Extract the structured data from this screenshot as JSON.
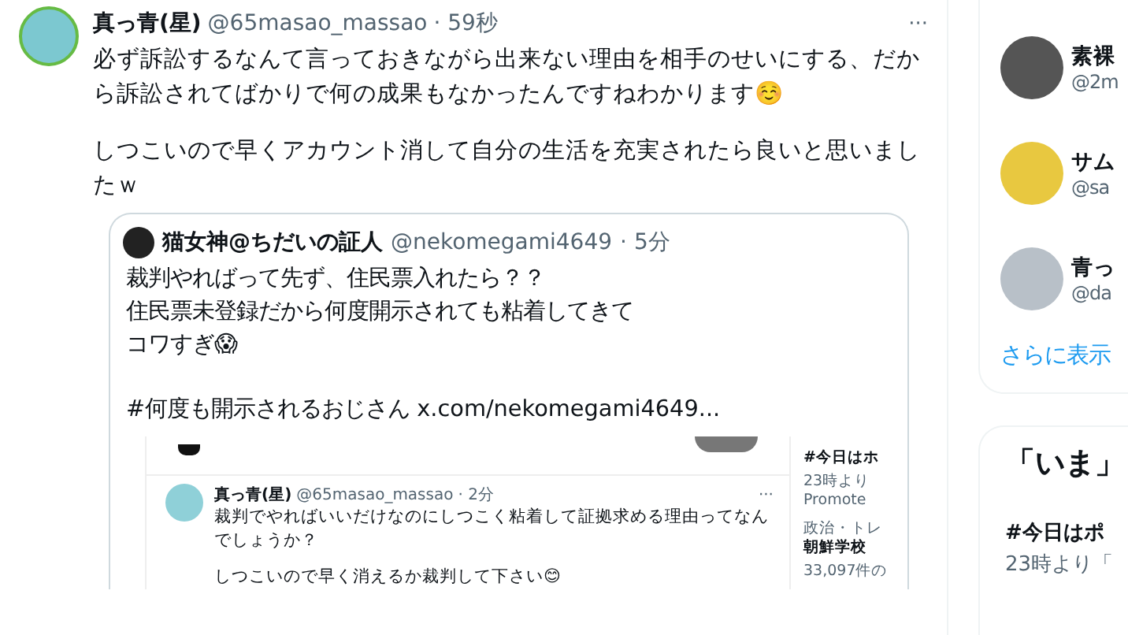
{
  "tweet": {
    "name": "真っ青(星)",
    "handle": "@65masao_massao",
    "time": "· 59秒",
    "more": "···",
    "paragraphs": [
      "必ず訴訟するなんて言っておきながら出来ない理由を相手のせいにする、だから訴訟されてばかりで何の成果もなかったんですねわかります☺️",
      "しつこいので早くアカウント消して自分の生活を充実されたら良いと思いましたｗ"
    ],
    "quote": {
      "name": "猫女神@ちだいの証人",
      "handle": "@nekomegami4649",
      "time": "· 5分",
      "paragraphs": [
        [
          "裁判やればって先ず、住民票入れたら？？",
          "住民票未登録だから何度開示されても粘着してきて",
          "コワすぎ😱"
        ],
        [
          "#何度も開示されるおじさん  x.com/nekomegami4649..."
        ]
      ],
      "image": {
        "tweet": {
          "name": "真っ青(星)",
          "handle": "@65masao_massao",
          "time": "· 2分",
          "more": "···",
          "paragraphs": [
            [
              "裁判でやればいいだけなのにしつこく粘着して証拠求める理由ってなんでしょうか？"
            ],
            [
              "しつこいので早く消えるか裁判して下さい😊"
            ]
          ]
        },
        "trends": [
          {
            "kind": "title",
            "text": "#今日はホ"
          },
          {
            "kind": "meta",
            "text": "23時より"
          },
          {
            "kind": "promo",
            "text": "Promote"
          },
          {
            "kind": "meta",
            "text": "政治・トレ"
          },
          {
            "kind": "title",
            "text": "朝鮮学校"
          },
          {
            "kind": "meta",
            "text": "33,097件の"
          }
        ]
      }
    }
  },
  "sidebar": {
    "users": [
      {
        "name": "素裸",
        "handle": "@2m"
      },
      {
        "name": "サム",
        "handle": "@sa"
      },
      {
        "name": "青っ",
        "handle": "@da"
      }
    ],
    "more": "さらに表示",
    "now": {
      "title": "「いま」",
      "trends": [
        {
          "kind": "title",
          "text": "#今日はポ"
        },
        {
          "kind": "meta",
          "text": "23時より「"
        }
      ]
    }
  }
}
